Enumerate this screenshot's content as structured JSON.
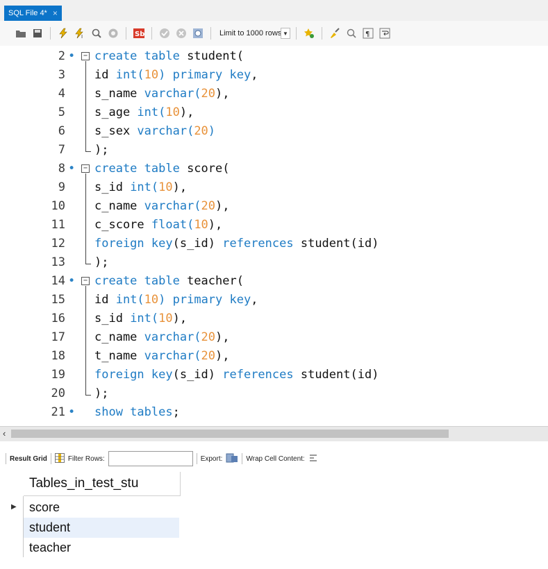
{
  "tab": {
    "title": "SQL File 4*",
    "close": "×"
  },
  "toolbar": {
    "limit_label": "Limit to 1000 rows",
    "icons": [
      "open-folder-icon",
      "save-icon",
      "execute-icon",
      "execute-current-icon",
      "explain-icon",
      "stop-icon",
      "toggle-error-icon",
      "commit-icon",
      "rollback-icon",
      "autocommit-icon",
      "limit-dropdown",
      "beautify-icon",
      "find-icon",
      "invisibles-icon",
      "wrap-icon"
    ]
  },
  "editor": {
    "lines": [
      {
        "n": "2",
        "marker": "•",
        "fold": "start",
        "tokens": [
          {
            "t": "create table",
            "k": "kw"
          },
          {
            "t": " student(",
            "k": ""
          }
        ]
      },
      {
        "n": "3",
        "tokens": [
          {
            "t": "id ",
            "k": ""
          },
          {
            "t": "int(",
            "k": "kw"
          },
          {
            "t": "10",
            "k": "num"
          },
          {
            "t": ") primary key",
            "k": "kw"
          },
          {
            "t": ",",
            "k": ""
          }
        ]
      },
      {
        "n": "4",
        "tokens": [
          {
            "t": "s_name ",
            "k": ""
          },
          {
            "t": "varchar(",
            "k": "kw"
          },
          {
            "t": "20",
            "k": "num"
          },
          {
            "t": "),",
            "k": ""
          }
        ]
      },
      {
        "n": "5",
        "tokens": [
          {
            "t": "s_age ",
            "k": ""
          },
          {
            "t": "int(",
            "k": "kw"
          },
          {
            "t": "10",
            "k": "num"
          },
          {
            "t": "),",
            "k": ""
          }
        ]
      },
      {
        "n": "6",
        "tokens": [
          {
            "t": "s_sex ",
            "k": ""
          },
          {
            "t": "varchar(",
            "k": "kw"
          },
          {
            "t": "20",
            "k": "num"
          },
          {
            "t": ")",
            "k": "kw"
          }
        ]
      },
      {
        "n": "7",
        "fold": "end",
        "tokens": [
          {
            "t": ");",
            "k": ""
          }
        ]
      },
      {
        "n": "8",
        "marker": "•",
        "fold": "start",
        "tokens": [
          {
            "t": "create table",
            "k": "kw"
          },
          {
            "t": " score(",
            "k": ""
          }
        ]
      },
      {
        "n": "9",
        "tokens": [
          {
            "t": "s_id ",
            "k": ""
          },
          {
            "t": "int(",
            "k": "kw"
          },
          {
            "t": "10",
            "k": "num"
          },
          {
            "t": "),",
            "k": ""
          }
        ]
      },
      {
        "n": "10",
        "tokens": [
          {
            "t": "c_name ",
            "k": ""
          },
          {
            "t": "varchar(",
            "k": "kw"
          },
          {
            "t": "20",
            "k": "num"
          },
          {
            "t": "),",
            "k": ""
          }
        ]
      },
      {
        "n": "11",
        "tokens": [
          {
            "t": "c_score ",
            "k": ""
          },
          {
            "t": "float(",
            "k": "kw"
          },
          {
            "t": "10",
            "k": "num"
          },
          {
            "t": "),",
            "k": ""
          }
        ]
      },
      {
        "n": "12",
        "tokens": [
          {
            "t": "foreign key",
            "k": "kw"
          },
          {
            "t": "(s_id) ",
            "k": ""
          },
          {
            "t": "references",
            "k": "kw"
          },
          {
            "t": " student(id)",
            "k": ""
          }
        ]
      },
      {
        "n": "13",
        "fold": "end",
        "tokens": [
          {
            "t": ");",
            "k": ""
          }
        ]
      },
      {
        "n": "14",
        "marker": "•",
        "fold": "start",
        "tokens": [
          {
            "t": "create table",
            "k": "kw"
          },
          {
            "t": " teacher(",
            "k": ""
          }
        ]
      },
      {
        "n": "15",
        "tokens": [
          {
            "t": "id ",
            "k": ""
          },
          {
            "t": "int(",
            "k": "kw"
          },
          {
            "t": "10",
            "k": "num"
          },
          {
            "t": ") primary key",
            "k": "kw"
          },
          {
            "t": ",",
            "k": ""
          }
        ]
      },
      {
        "n": "16",
        "tokens": [
          {
            "t": "s_id ",
            "k": ""
          },
          {
            "t": "int(",
            "k": "kw"
          },
          {
            "t": "10",
            "k": "num"
          },
          {
            "t": "),",
            "k": ""
          }
        ]
      },
      {
        "n": "17",
        "tokens": [
          {
            "t": "c_name ",
            "k": ""
          },
          {
            "t": "varchar(",
            "k": "kw"
          },
          {
            "t": "20",
            "k": "num"
          },
          {
            "t": "),",
            "k": ""
          }
        ]
      },
      {
        "n": "18",
        "tokens": [
          {
            "t": "t_name ",
            "k": ""
          },
          {
            "t": "varchar(",
            "k": "kw"
          },
          {
            "t": "20",
            "k": "num"
          },
          {
            "t": "),",
            "k": ""
          }
        ]
      },
      {
        "n": "19",
        "tokens": [
          {
            "t": "foreign key",
            "k": "kw"
          },
          {
            "t": "(s_id) ",
            "k": ""
          },
          {
            "t": "references",
            "k": "kw"
          },
          {
            "t": " student(id)",
            "k": ""
          }
        ]
      },
      {
        "n": "20",
        "fold": "end",
        "tokens": [
          {
            "t": ");",
            "k": ""
          }
        ]
      },
      {
        "n": "21",
        "marker": "•",
        "tokens": [
          {
            "t": "show tables",
            "k": "kw"
          },
          {
            "t": ";",
            "k": ""
          }
        ]
      }
    ]
  },
  "results_toolbar": {
    "result_grid": "Result Grid",
    "filter_rows": "Filter Rows:",
    "export": "Export:",
    "wrap": "Wrap Cell Content:"
  },
  "result": {
    "header": "Tables_in_test_stu",
    "rows": [
      "score",
      "student",
      "teacher"
    ],
    "selected_row": 0,
    "hover_row": 1
  },
  "colors": {
    "tab": "#0c74c9",
    "keyword": "#1e7bc4",
    "number": "#e8923a",
    "hover_row": "#e8f0fb"
  }
}
